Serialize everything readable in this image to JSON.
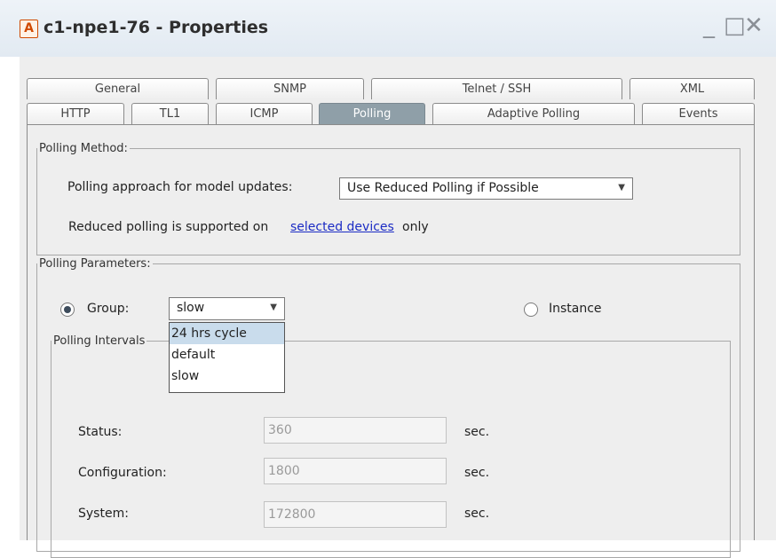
{
  "window": {
    "app_icon": "A",
    "title": "c1-npe1-76 - Properties",
    "controls": {
      "minimize": "_",
      "maximize": "□",
      "close": "✕"
    }
  },
  "tabs": {
    "row1": [
      {
        "label": "General"
      },
      {
        "label": "SNMP"
      },
      {
        "label": "Telnet / SSH"
      },
      {
        "label": "XML"
      }
    ],
    "row2": [
      {
        "label": "HTTP"
      },
      {
        "label": "TL1"
      },
      {
        "label": "ICMP"
      },
      {
        "label": "Polling",
        "active": true
      },
      {
        "label": "Adaptive Polling"
      },
      {
        "label": "Events"
      }
    ]
  },
  "polling_method": {
    "legend": "Polling Method:",
    "approach_label": "Polling approach for model updates:",
    "approach_value": "Use Reduced Polling if Possible",
    "note_prefix": "Reduced polling is supported on ",
    "note_link": "selected devices",
    "note_suffix": " only"
  },
  "polling_parameters": {
    "legend": "Polling Parameters:",
    "group_label": "Group:",
    "group_selected": true,
    "group_value": "slow",
    "group_options": [
      "24 hrs cycle",
      "default",
      "slow"
    ],
    "instance_label": "Instance",
    "instance_selected": false
  },
  "polling_intervals": {
    "legend": "Polling Intervals",
    "rows": [
      {
        "label": "Status:",
        "value": "360",
        "unit": "sec."
      },
      {
        "label": "Configuration:",
        "value": "1800",
        "unit": "sec."
      },
      {
        "label": "System:",
        "value": "172800",
        "unit": "sec."
      }
    ]
  },
  "colors": {
    "active_tab": "#8f9fa8",
    "link": "#1b2bc4",
    "highlight": "#c9dcec",
    "app_icon": "#d04a00"
  }
}
